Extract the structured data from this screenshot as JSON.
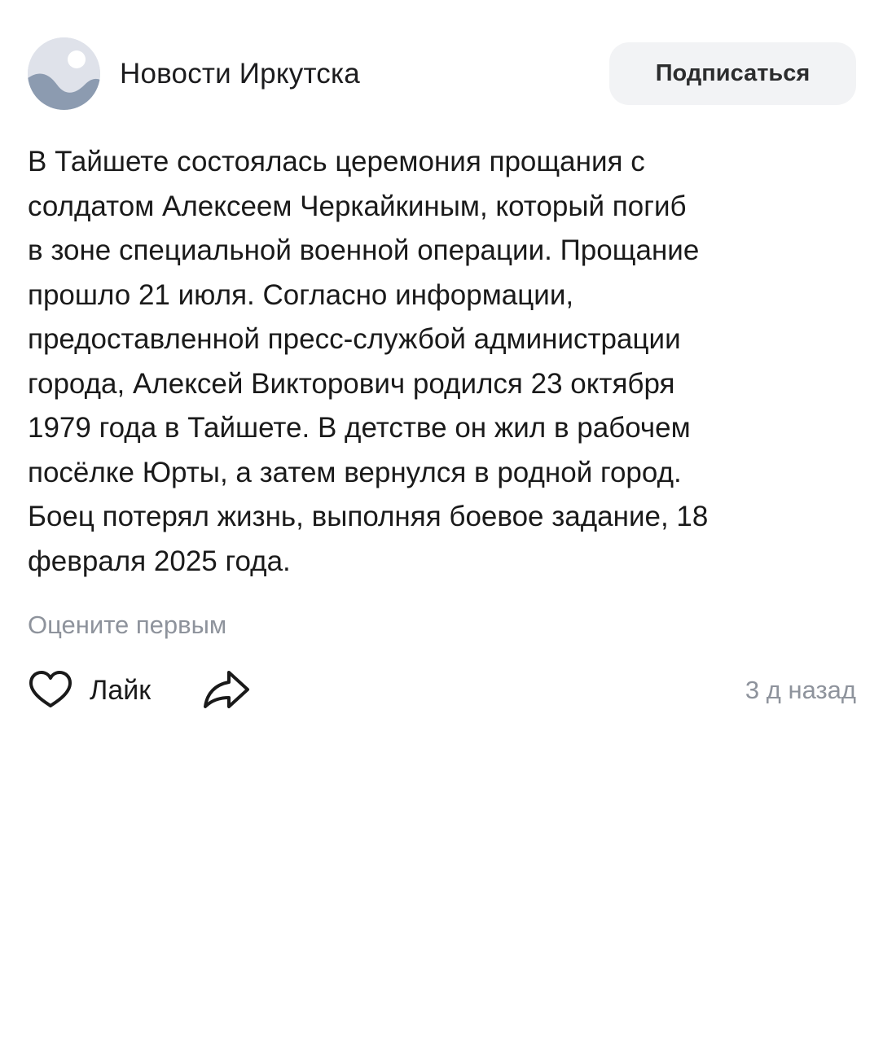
{
  "header": {
    "group_name": "Новости Иркутска",
    "subscribe_label": "Подписаться",
    "avatar_icon": "landscape-avatar-icon"
  },
  "post": {
    "text_lines": [
      "В Тайшете состоялась церемония прощания с",
      "солдатом Алексеем Черкайкиным, который погиб",
      "в зоне специальной военной операции. Прощание",
      "прошло 21 июля. Согласно информации,",
      "предоставленной пресс-службой администрации",
      "города, Алексей Викторович родился 23 октября",
      "1979 года в Тайшете. В детстве он жил в рабочем",
      "посёлке Юрты, а затем вернулся в родной город.",
      "Боец потерял жизнь, выполняя боевое задание, 18",
      "февраля 2025 года."
    ]
  },
  "rating": {
    "prompt": "Оцените первым"
  },
  "actions": {
    "like_label": "Лайк",
    "like_icon": "heart-icon",
    "share_icon": "share-arrow-icon",
    "timestamp": "3 д назад"
  },
  "colors": {
    "text": "#1a1a1a",
    "secondary": "#8e939c",
    "button_bg": "#f2f3f5"
  }
}
